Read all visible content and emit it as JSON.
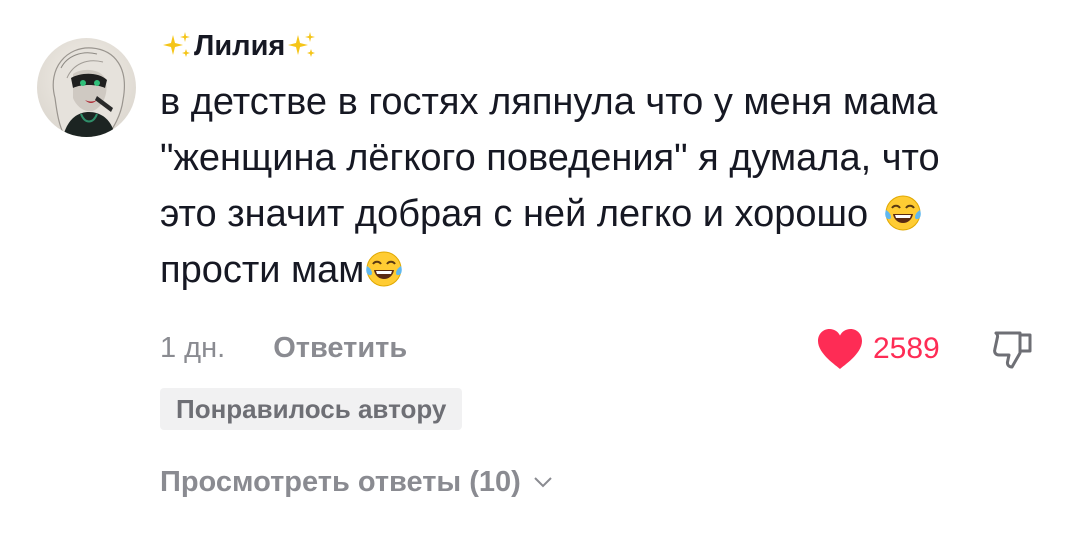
{
  "comment": {
    "username": "Лилия",
    "username_decoration": "sparkles-icon",
    "text_lines": [
      "в детстве в гостях ляпнула что у меня мама",
      "\"женщина лёгкого поведения\" я думала, что",
      "это значит добрая с ней легко и хорошо",
      "прости мам"
    ],
    "emoji": "face-with-tears-of-joy-icon",
    "time": "1 дн.",
    "reply_label": "Ответить",
    "like_count": "2589",
    "author_badge": "Понравилось автору",
    "view_replies": "Просмотреть ответы (10)"
  },
  "colors": {
    "like": "#fe2c55",
    "secondary_text": "#8a8b91",
    "primary_text": "#161823",
    "badge_bg": "#f1f1f2"
  }
}
